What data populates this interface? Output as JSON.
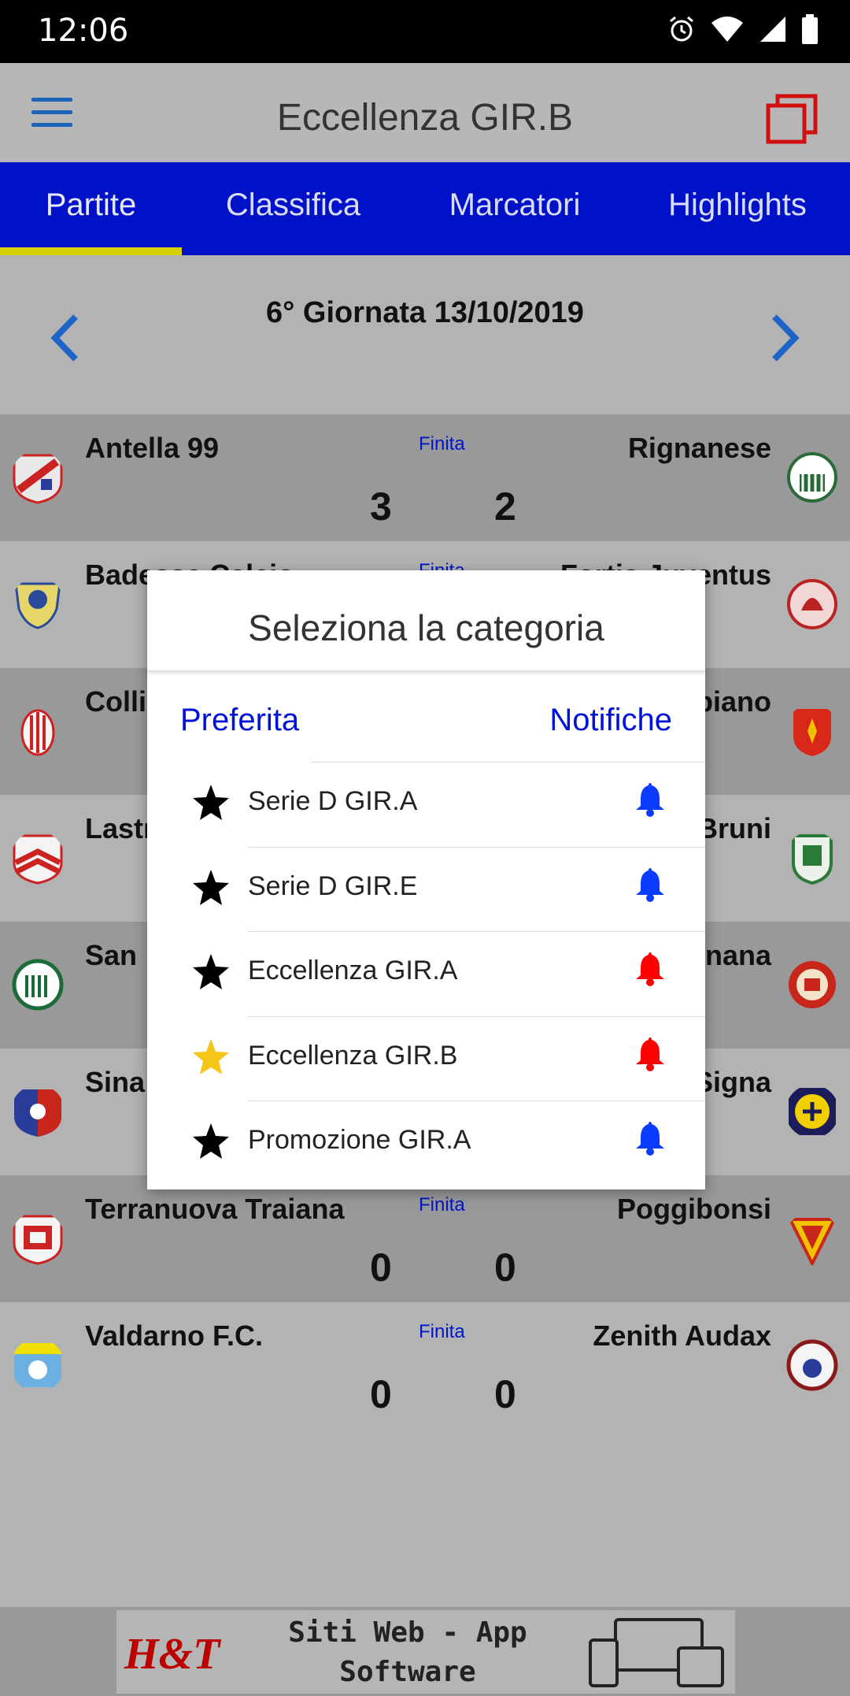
{
  "status_bar": {
    "time": "12:06"
  },
  "app_bar": {
    "title": "Eccellenza GIR.B"
  },
  "tabs": [
    {
      "label": "Partite",
      "active": true
    },
    {
      "label": "Classifica",
      "active": false
    },
    {
      "label": "Marcatori",
      "active": false
    },
    {
      "label": "Highlights",
      "active": false
    }
  ],
  "round": {
    "label": "6° Giornata 13/10/2019"
  },
  "matches": [
    {
      "home": "Antella 99",
      "away": "Rignanese",
      "status": "Finita",
      "score_home": "3",
      "score_away": "2"
    },
    {
      "home": "Badesse Calcio",
      "away": "Fortis Juventus",
      "status": "Finita",
      "score_home": "",
      "score_away": ""
    },
    {
      "home": "Colli",
      "away": "piano",
      "status": "",
      "score_home": "",
      "score_away": ""
    },
    {
      "home": "Lastr",
      "away": "Bruni",
      "status": "",
      "score_home": "",
      "score_away": ""
    },
    {
      "home": "San",
      "away": "nana",
      "status": "",
      "score_home": "",
      "score_away": ""
    },
    {
      "home": "Sina",
      "away": "Signa",
      "status": "",
      "score_home": "",
      "score_away": ""
    },
    {
      "home": "Terranuova Traiana",
      "away": "Poggibonsi",
      "status": "Finita",
      "score_home": "0",
      "score_away": "0"
    },
    {
      "home": "Valdarno F.C.",
      "away": "Zenith Audax",
      "status": "Finita",
      "score_home": "0",
      "score_away": "0"
    }
  ],
  "modal": {
    "title": "Seleziona la categoria",
    "col_favorite": "Preferita",
    "col_notifications": "Notifiche",
    "categories": [
      {
        "name": "Serie D GIR.A",
        "favorite": false,
        "notify": false
      },
      {
        "name": "Serie D GIR.E",
        "favorite": false,
        "notify": false
      },
      {
        "name": "Eccellenza GIR.A",
        "favorite": false,
        "notify": true
      },
      {
        "name": "Eccellenza GIR.B",
        "favorite": true,
        "notify": true
      },
      {
        "name": "Promozione GIR.A",
        "favorite": false,
        "notify": false
      }
    ]
  },
  "banner": {
    "brand": "H&T",
    "line1": "Siti Web - App",
    "line2": "Software"
  },
  "colors": {
    "tab_bar": "#0012c8",
    "tab_indicator": "#d6d000",
    "link_blue": "#0012d6",
    "star_active": "#f5c518",
    "bell_on": "#ff0000",
    "bell_off": "#0a3cff"
  }
}
